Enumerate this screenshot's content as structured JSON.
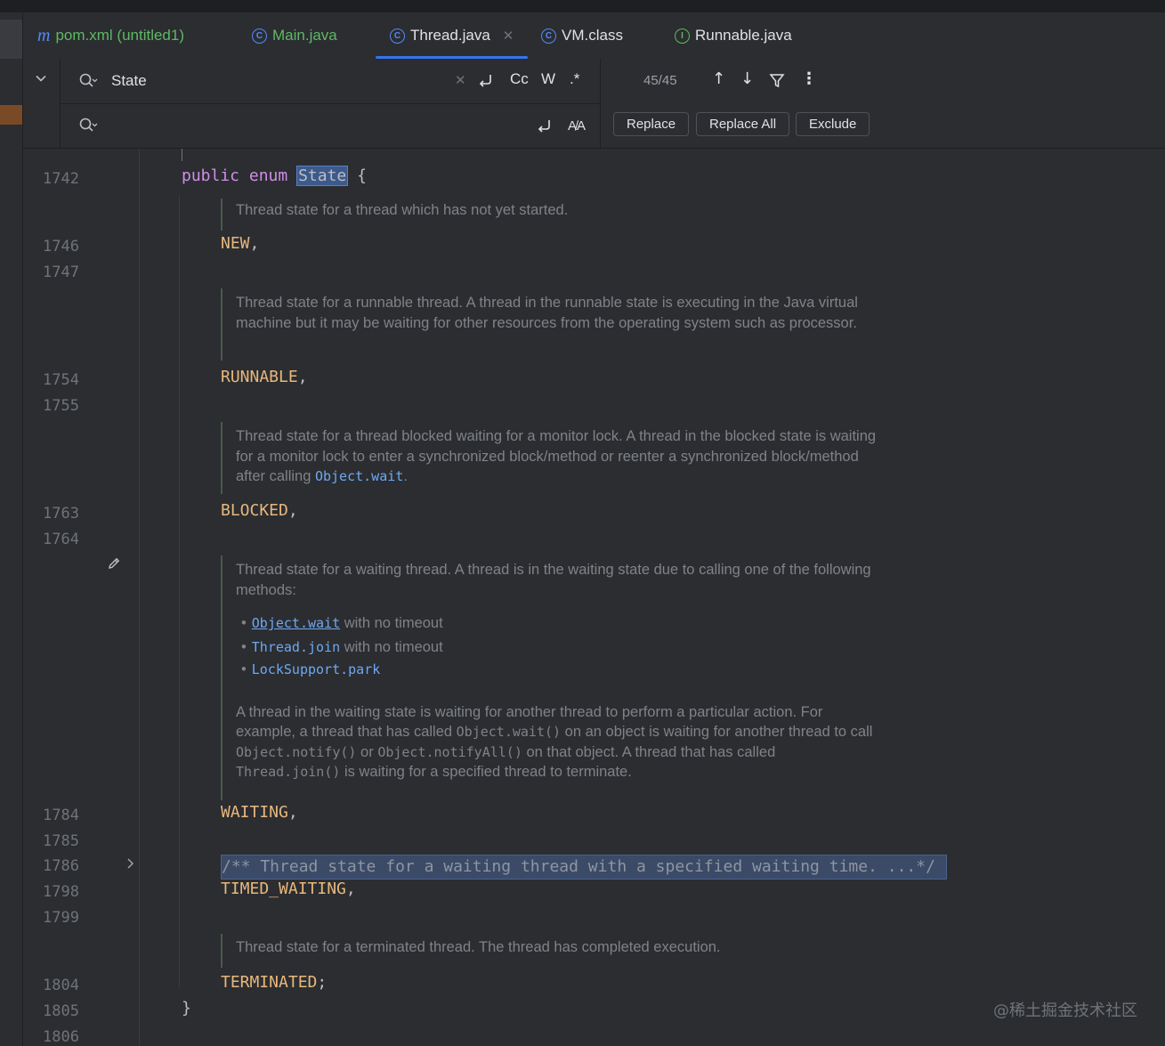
{
  "tabs": [
    {
      "label": "pom.xml (untitled1)",
      "icon": "maven-icon",
      "color": "#5fb865"
    },
    {
      "label": "Main.java",
      "icon": "class-icon",
      "color": "#5fb865"
    },
    {
      "label": "Thread.java",
      "icon": "class-icon",
      "color": "#dfe1e5",
      "active": true
    },
    {
      "label": "VM.class",
      "icon": "class-icon",
      "color": "#dfe1e5"
    },
    {
      "label": "Runnable.java",
      "icon": "interface-icon",
      "color": "#dfe1e5"
    }
  ],
  "find": {
    "query": "State",
    "options": {
      "case": "Cc",
      "word": "W",
      "regex": ".*"
    },
    "match_count": "45/45",
    "replace_icon_label": "A̸A"
  },
  "replace": {
    "replace_label": "Replace",
    "replace_all_label": "Replace All",
    "exclude_label": "Exclude"
  },
  "gutter": {
    "lines": [
      "1742",
      "1746",
      "1747",
      "1754",
      "1755",
      "1763",
      "1764",
      "1784",
      "1785",
      "1786",
      "1798",
      "1799",
      "1804",
      "1805",
      "1806"
    ]
  },
  "code": {
    "decl_kw1": "public",
    "decl_kw2": "enum",
    "decl_name": "State",
    "decl_brace": "{",
    "doc_new": "Thread state for a thread which has not yet started.",
    "const_new": "NEW",
    "doc_runnable": "Thread state for a runnable thread. A thread in the runnable state is executing in the Java virtual machine but it may be waiting for other resources from the operating system such as processor.",
    "const_runnable": "RUNNABLE",
    "doc_blocked_text": "Thread state for a thread blocked waiting for a monitor lock. A thread in the blocked state is waiting for a monitor lock to enter a synchronized block/method or reenter a synchronized block/method after calling ",
    "doc_blocked_link": "Object.wait",
    "doc_blocked_end": ".",
    "const_blocked": "BLOCKED",
    "doc_waiting_intro": "Thread state for a waiting thread. A thread is in the waiting state due to calling one of the following methods:",
    "doc_waiting_items": [
      {
        "link": "Object.wait",
        "rest": " with no timeout"
      },
      {
        "link": "Thread.join",
        "rest": " with no timeout"
      },
      {
        "link": "LockSupport.park",
        "rest": ""
      }
    ],
    "doc_waiting_p2_a": "A thread in the waiting state is waiting for another thread to perform a particular action. For example, a thread that has called ",
    "doc_waiting_p2_m1": "Object.wait()",
    "doc_waiting_p2_b": " on an object is waiting for another thread to call ",
    "doc_waiting_p2_m2": "Object.notify()",
    "doc_waiting_p2_c": " or ",
    "doc_waiting_p2_m3": "Object.notifyAll()",
    "doc_waiting_p2_d": " on that object. A thread that has called ",
    "doc_waiting_p2_m4": "Thread.join()",
    "doc_waiting_p2_e": " is waiting for a specified thread to terminate.",
    "const_waiting": "WAITING",
    "folded_comment": "/** Thread state for a waiting thread with a specified waiting time. ...*/",
    "const_timed": "TIMED_WAITING",
    "doc_terminated": "Thread state for a terminated thread. The thread has completed execution.",
    "const_terminated": "TERMINATED",
    "close_brace": "}"
  },
  "watermark": "@稀土掘金技术社区"
}
